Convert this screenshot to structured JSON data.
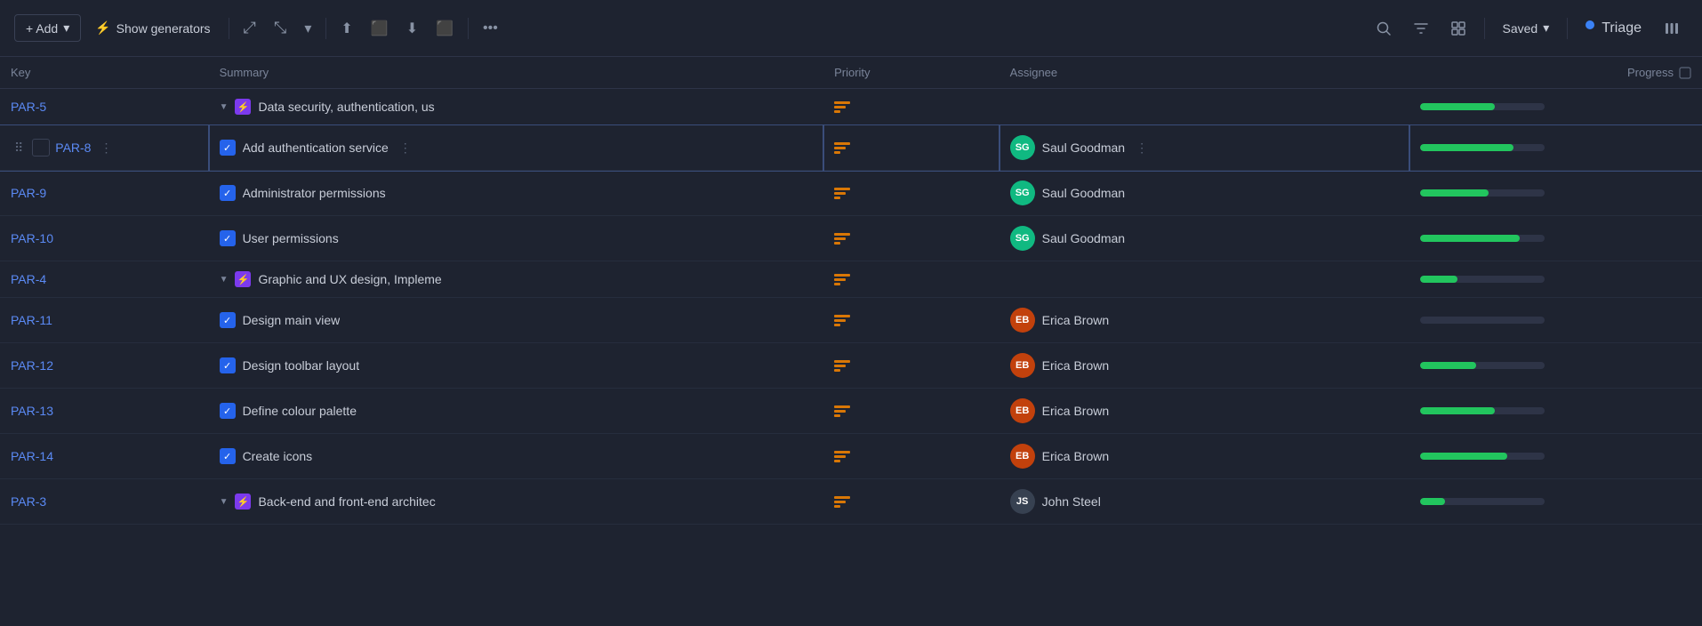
{
  "toolbar": {
    "add_label": "+ Add",
    "add_dropdown_icon": "▾",
    "show_generators_label": "Show generators",
    "show_generators_icon": "⚡",
    "expand_icon": "⤢",
    "compress_icon": "⤡",
    "dropdown_icon": "▾",
    "upload_icon": "⬆",
    "filter_icon": "⬛",
    "download_icon": "⬇",
    "table_icon": "⊞",
    "more_icon": "•••",
    "search_icon": "🔍",
    "funnel_icon": "⊿",
    "view_icon": "⊟",
    "saved_label": "Saved",
    "saved_dropdown": "▾",
    "triage_label": "Triage",
    "triage_dot": true,
    "bars_icon": "|||"
  },
  "table": {
    "columns": [
      {
        "id": "key",
        "label": "Key"
      },
      {
        "id": "summary",
        "label": "Summary"
      },
      {
        "id": "priority",
        "label": "Priority"
      },
      {
        "id": "assignee",
        "label": "Assignee"
      },
      {
        "id": "progress",
        "label": "Progress"
      }
    ],
    "rows": [
      {
        "key": "PAR-5",
        "summary": "Data security, authentication, us",
        "summary_full": "Data security, authentication, user management",
        "type": "epic",
        "is_parent": true,
        "priority": "medium",
        "assignee_name": "",
        "assignee_initials": "",
        "assignee_type": "",
        "progress": 60
      },
      {
        "key": "PAR-8",
        "summary": "Add authentication service",
        "type": "task",
        "is_parent": false,
        "is_highlighted": true,
        "priority": "medium",
        "assignee_name": "Saul Goodman",
        "assignee_initials": "SG",
        "assignee_type": "sg",
        "progress": 75
      },
      {
        "key": "PAR-9",
        "summary": "Administrator permissions",
        "type": "task",
        "is_parent": false,
        "priority": "medium",
        "assignee_name": "Saul Goodman",
        "assignee_initials": "SG",
        "assignee_type": "sg",
        "progress": 55
      },
      {
        "key": "PAR-10",
        "summary": "User permissions",
        "type": "task",
        "is_parent": false,
        "priority": "medium",
        "assignee_name": "Saul Goodman",
        "assignee_initials": "SG",
        "assignee_type": "sg",
        "progress": 80
      },
      {
        "key": "PAR-4",
        "summary": "Graphic and UX design, Impleme",
        "summary_full": "Graphic and UX design, Implementation",
        "type": "epic",
        "is_parent": true,
        "priority": "medium",
        "assignee_name": "",
        "assignee_initials": "",
        "assignee_type": "",
        "progress": 30
      },
      {
        "key": "PAR-11",
        "summary": "Design main view",
        "type": "task",
        "is_parent": false,
        "priority": "medium",
        "assignee_name": "Erica Brown",
        "assignee_initials": "EB",
        "assignee_type": "eb",
        "progress": 0
      },
      {
        "key": "PAR-12",
        "summary": "Design toolbar layout",
        "type": "task",
        "is_parent": false,
        "priority": "medium",
        "assignee_name": "Erica Brown",
        "assignee_initials": "EB",
        "assignee_type": "eb",
        "progress": 45
      },
      {
        "key": "PAR-13",
        "summary": "Define colour palette",
        "type": "task",
        "is_parent": false,
        "priority": "medium",
        "assignee_name": "Erica Brown",
        "assignee_initials": "EB",
        "assignee_type": "eb",
        "progress": 60
      },
      {
        "key": "PAR-14",
        "summary": "Create icons",
        "type": "task",
        "is_parent": false,
        "priority": "medium",
        "assignee_name": "Erica Brown",
        "assignee_initials": "EB",
        "assignee_type": "eb",
        "progress": 70
      },
      {
        "key": "PAR-3",
        "summary": "Back-end and front-end architec",
        "summary_full": "Back-end and front-end architecture",
        "type": "epic",
        "is_parent": true,
        "priority": "medium",
        "assignee_name": "John Steel",
        "assignee_initials": "JS",
        "assignee_type": "js",
        "progress": 20
      }
    ]
  }
}
